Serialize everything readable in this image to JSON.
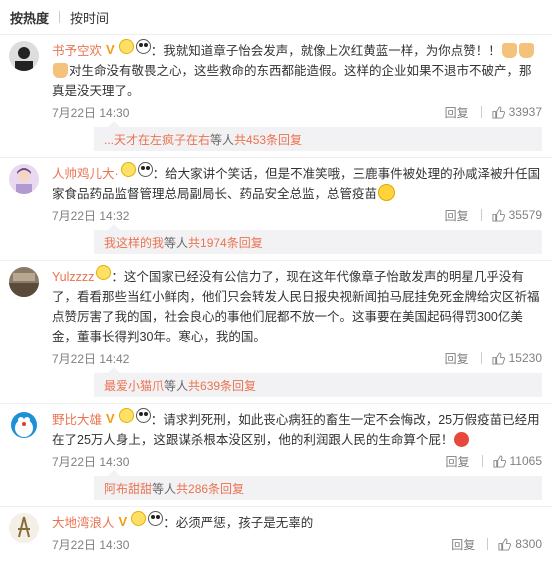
{
  "tabs": {
    "hot": "按热度",
    "time": "按时间"
  },
  "comments": [
    {
      "user": "书予空欢",
      "text_before": "：我就知道章子怡会发声，就像上次红黄蓝一样，为你点赞！！",
      "text_after": "对生命没有敬畏之心，这些救命的东西都能造假。这样的企业如果不退市不破产，那真是没天理了。",
      "time": "7月22日 14:30",
      "reply": "回复",
      "likes": "33937",
      "more_user": "...天才在左疯子在右",
      "more_mid": " 等人 ",
      "more_count": "共453条回复"
    },
    {
      "user": "人帅鸡儿大·",
      "text": "：给大家讲个笑话，但是不准笑哦，三鹿事件被处理的孙咸泽被升任国家食品药品监督管理总局副局长、药品安全总监，总管疫苗",
      "time": "7月22日 14:32",
      "reply": "回复",
      "likes": "35579",
      "more_user": "我这样的我",
      "more_mid": " 等人 ",
      "more_count": "共1974条回复"
    },
    {
      "user": "Yulzzzz",
      "text": "：这个国家已经没有公信力了，现在这年代像章子怡敢发声的明星几乎没有了，看看那些当红小鲜肉，他们只会转发人民日报央视新闻拍马屁挂免死金牌给灾区祈福点赞厉害了我的国，社会良心的事他们屁都不放一个。这事要在美国起码得罚300亿美金，董事长得判30年。寒心，我的国。",
      "time": "7月22日 14:42",
      "reply": "回复",
      "likes": "15230",
      "more_user": "最爱小猫爪",
      "more_mid": " 等人 ",
      "more_count": "共639条回复"
    },
    {
      "user": "野比大雄",
      "text": "：请求判死刑，如此丧心病狂的畜生一定不会悔改，25万假疫苗已经用在了25万人身上，这跟谋杀根本没区别，他的利润跟人民的生命算个屁！",
      "time": "7月22日 14:30",
      "reply": "回复",
      "likes": "11065",
      "more_user": "阿布甜甜",
      "more_mid": " 等人 ",
      "more_count": "共286条回复"
    },
    {
      "user": "大地湾浪人",
      "text": "：必须严惩，孩子是无辜的",
      "time": "7月22日 14:30",
      "reply": "回复",
      "likes": "8300"
    }
  ]
}
